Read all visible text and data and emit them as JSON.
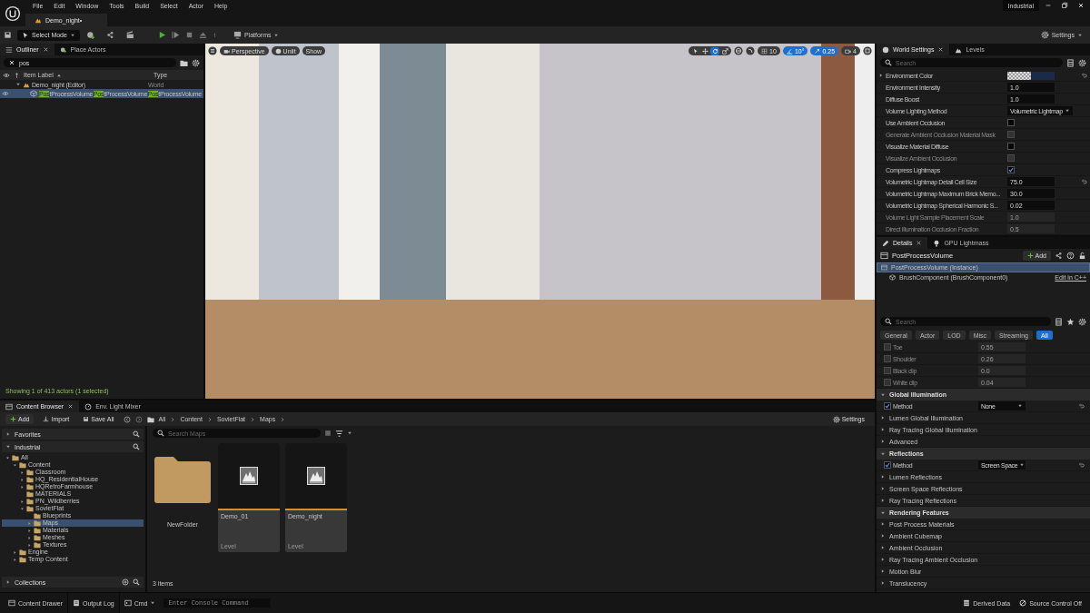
{
  "menu": [
    "File",
    "Edit",
    "Window",
    "Tools",
    "Build",
    "Select",
    "Actor",
    "Help"
  ],
  "layout_badge": "Industrial",
  "document_tab": {
    "label": "Demo_night•"
  },
  "toolbar": {
    "mode_button": "Select Mode",
    "platforms_button": "Platforms",
    "settings_button": "Settings"
  },
  "outliner": {
    "tabs": [
      {
        "label": "Outliner",
        "selected": true
      },
      {
        "label": "Place Actors",
        "selected": false
      }
    ],
    "search": "pos",
    "columns": [
      "Item Label",
      "Type"
    ],
    "rows": [
      {
        "label": "Demo_night (Editor)",
        "type": "World",
        "visible": false,
        "selected": false,
        "children": [
          {
            "label": "**Pos**tProcessVolume",
            "column_2": "**Pos**tProcessVolume",
            "type": "**Pos**tProcessVolume",
            "visible": true,
            "selected": true
          }
        ]
      }
    ],
    "status": "Showing 1 of 413 actors (1 selected)"
  },
  "viewport": {
    "view_buttons": [
      "Perspective",
      "Unlit",
      "Show"
    ],
    "transform_tools": [
      {
        "kind": "select",
        "selected": false
      },
      {
        "kind": "move",
        "selected": false
      },
      {
        "kind": "rotate",
        "selected": true
      },
      {
        "kind": "scale",
        "selected": false
      }
    ],
    "snaps": [
      {
        "kind": "grid",
        "label": "10",
        "on": false
      },
      {
        "kind": "rotation",
        "label": "10°",
        "on": true
      },
      {
        "kind": "scale",
        "label": "0.25",
        "on": true
      },
      {
        "kind": "camera",
        "label": "4",
        "on": false
      }
    ]
  },
  "world_settings": {
    "tabs": [
      {
        "label": "World Settings",
        "selected": true
      },
      {
        "label": "Levels",
        "selected": false
      }
    ],
    "search_placeholder": "Search",
    "properties": [
      {
        "kind": "color",
        "label": "Environment Color",
        "disabled": false,
        "modified": true
      },
      {
        "kind": "number",
        "label": "Environment Intensity",
        "value": "1.0",
        "disabled": false,
        "modified": false
      },
      {
        "kind": "number",
        "label": "Diffuse Boost",
        "value": "1.0",
        "disabled": false,
        "modified": false
      },
      {
        "kind": "dropdown",
        "label": "Volume Lighting Method",
        "value": "Volumetric Lightmap",
        "disabled": false,
        "modified": false
      },
      {
        "kind": "checkbox",
        "label": "Use Ambient Occlusion",
        "checked": false,
        "disabled": false,
        "modified": false
      },
      {
        "kind": "checkbox",
        "label": "Generate Ambient Occlusion Material Mask",
        "checked": false,
        "disabled": true,
        "modified": false
      },
      {
        "kind": "checkbox",
        "label": "Visualize Material Diffuse",
        "checked": false,
        "disabled": false,
        "modified": false
      },
      {
        "kind": "checkbox",
        "label": "Visualize Ambient Occlusion",
        "checked": false,
        "disabled": true,
        "modified": false
      },
      {
        "kind": "checkbox",
        "label": "Compress Lightmaps",
        "checked": true,
        "disabled": false,
        "modified": false
      },
      {
        "kind": "number",
        "label": "Volumetric Lightmap Detail Cell Size",
        "value": "75.0",
        "disabled": false,
        "modified": true
      },
      {
        "kind": "number",
        "label": "Volumetric Lightmap Maximum Brick Memo...",
        "value": "30.0",
        "disabled": false,
        "modified": false
      },
      {
        "kind": "number",
        "label": "Volumetric Lightmap Spherical Harmonic S...",
        "value": "0.02",
        "disabled": false,
        "modified": false
      },
      {
        "kind": "number",
        "label": "Volume Light Sample Placement Scale",
        "value": "1.0",
        "disabled": true,
        "modified": false
      },
      {
        "kind": "number",
        "label": "Direct Illumination Occlusion Fraction",
        "value": "0.5",
        "disabled": true,
        "modified": false
      }
    ]
  },
  "details": {
    "tabs": [
      {
        "label": "Details",
        "selected": true
      },
      {
        "label": "GPU Lightmass",
        "selected": false
      }
    ],
    "title": "PostProcessVolume",
    "add_button": "Add",
    "components": [
      {
        "label": "PostProcessVolume (Instance)",
        "selected": true
      },
      {
        "label": "BrushComponent (BrushComponent0)",
        "selected": false
      }
    ],
    "edit_link": "Edit in C++",
    "search_placeholder": "Search",
    "filters": [
      {
        "label": "General",
        "selected": false
      },
      {
        "label": "Actor",
        "selected": false
      },
      {
        "label": "LOD",
        "selected": false
      },
      {
        "label": "Misc",
        "selected": false
      },
      {
        "label": "Streaming",
        "selected": false
      },
      {
        "label": "All",
        "selected": true
      }
    ],
    "properties": [
      {
        "kind": "param",
        "label": "Toe",
        "value": "0.55",
        "checked": false
      },
      {
        "kind": "param",
        "label": "Shoulder",
        "value": "0.26",
        "checked": false
      },
      {
        "kind": "param",
        "label": "Black clip",
        "value": "0.0",
        "checked": false
      },
      {
        "kind": "param",
        "label": "White clip",
        "value": "0.04",
        "checked": false
      },
      {
        "kind": "section",
        "label": "Global Illumination",
        "expanded": true
      },
      {
        "kind": "override",
        "label": "Method",
        "value": "None",
        "checked": true,
        "modified": true
      },
      {
        "kind": "group",
        "label": "Lumen Global Illumination",
        "expanded": false
      },
      {
        "kind": "group",
        "label": "Ray Tracing Global Illumination",
        "expanded": false
      },
      {
        "kind": "group",
        "label": "Advanced",
        "expanded": false
      },
      {
        "kind": "section",
        "label": "Reflections",
        "expanded": true
      },
      {
        "kind": "override",
        "label": "Method",
        "value": "Screen Space",
        "checked": true,
        "modified": true
      },
      {
        "kind": "group",
        "label": "Lumen Reflections",
        "expanded": false
      },
      {
        "kind": "group",
        "label": "Screen Space Reflections",
        "expanded": false
      },
      {
        "kind": "group",
        "label": "Ray Tracing Reflections",
        "expanded": false
      },
      {
        "kind": "section",
        "label": "Rendering Features",
        "expanded": true
      },
      {
        "kind": "group",
        "label": "Post Process Materials",
        "expanded": false
      },
      {
        "kind": "group",
        "label": "Ambient Cubemap",
        "expanded": false
      },
      {
        "kind": "group",
        "label": "Ambient Occlusion",
        "expanded": false
      },
      {
        "kind": "group",
        "label": "Ray Tracing Ambient Occlusion",
        "expanded": false
      },
      {
        "kind": "group",
        "label": "Motion Blur",
        "expanded": false
      },
      {
        "kind": "group",
        "label": "Translucency",
        "expanded": false
      }
    ]
  },
  "content_browser": {
    "tabs": [
      {
        "label": "Content Browser",
        "selected": true
      },
      {
        "label": "Env. Light Mixer",
        "selected": false
      }
    ],
    "add_button": "Add",
    "import_button": "Import",
    "save_all_button": "Save All",
    "breadcrumbs": [
      "All",
      "Content",
      "SovietFlat",
      "Maps"
    ],
    "settings_button": "Settings",
    "favorites": {
      "label": "Favorites",
      "expanded": false
    },
    "project": {
      "label": "Industrial",
      "expanded": true
    },
    "tree": [
      {
        "label": "All",
        "expandable": true,
        "expanded": true,
        "selected": false,
        "children": [
          {
            "label": "Content",
            "expandable": true,
            "expanded": true,
            "selected": false,
            "children": [
              {
                "label": "Classroom",
                "expandable": true,
                "expanded": false,
                "selected": false
              },
              {
                "label": "HQ_ResidentialHouse",
                "expandable": true,
                "expanded": false,
                "selected": false
              },
              {
                "label": "HQRetroFarmhouse",
                "expandable": true,
                "expanded": false,
                "selected": false
              },
              {
                "label": "MATERIALS",
                "expandable": false,
                "expanded": false,
                "selected": false
              },
              {
                "label": "PN_Wildberries",
                "expandable": true,
                "expanded": false,
                "selected": false
              },
              {
                "label": "SovietFlat",
                "expandable": true,
                "expanded": true,
                "selected": false,
                "children": [
                  {
                    "label": "Blueprints",
                    "expandable": false,
                    "expanded": false,
                    "selected": false
                  },
                  {
                    "label": "Maps",
                    "expandable": true,
                    "expanded": false,
                    "selected": true
                  },
                  {
                    "label": "Materials",
                    "expandable": true,
                    "expanded": false,
                    "selected": false
                  },
                  {
                    "label": "Meshes",
                    "expandable": true,
                    "expanded": false,
                    "selected": false
                  },
                  {
                    "label": "Textures",
                    "expandable": true,
                    "expanded": false,
                    "selected": false
                  }
                ]
              }
            ]
          },
          {
            "label": "Engine",
            "expandable": true,
            "expanded": false,
            "selected": false
          },
          {
            "label": "Temp Content",
            "expandable": true,
            "expanded": false,
            "selected": false
          }
        ]
      }
    ],
    "collections": {
      "label": "Collections",
      "expanded": false
    },
    "search_placeholder": "Search Maps",
    "assets": [
      {
        "kind": "folder",
        "name": "NewFolder"
      },
      {
        "kind": "level",
        "name": "Demo_01",
        "type": "Level"
      },
      {
        "kind": "level",
        "name": "Demo_night",
        "type": "Level"
      }
    ],
    "item_count": "3 items"
  },
  "status_bar": {
    "content_drawer": "Content Drawer",
    "output_log": "Output Log",
    "cmd": "Cmd",
    "console_placeholder": "Enter Console Command",
    "derived_data": "Derived Data",
    "source_control": "Source Control Off"
  }
}
